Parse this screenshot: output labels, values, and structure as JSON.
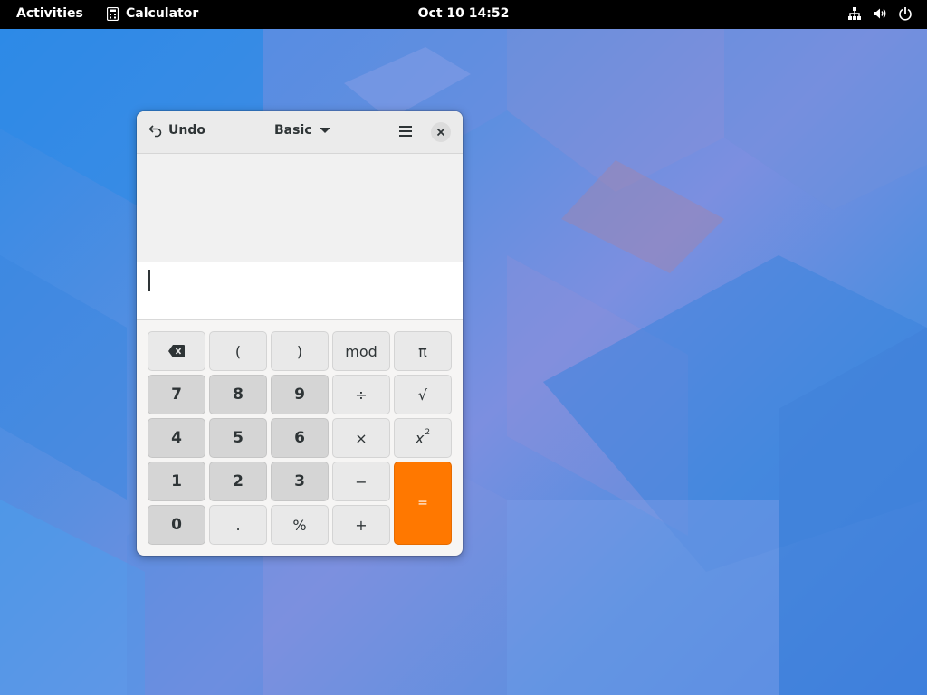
{
  "topbar": {
    "activities_label": "Activities",
    "app_name": "Calculator",
    "clock": "Oct 10  14:52",
    "tray_icons": [
      "network-icon",
      "volume-icon",
      "power-icon"
    ]
  },
  "window": {
    "undo_label": "Undo",
    "mode_label": "Basic",
    "entry_value": "",
    "keys": {
      "backspace": "backspace-icon",
      "lparen": "(",
      "rparen": ")",
      "mod": "mod",
      "pi": "π",
      "k7": "7",
      "k8": "8",
      "k9": "9",
      "divide": "÷",
      "sqrt": "√",
      "k4": "4",
      "k5": "5",
      "k6": "6",
      "multiply": "×",
      "square_base": "x",
      "square_exp": "2",
      "k1": "1",
      "k2": "2",
      "k3": "3",
      "subtract": "−",
      "equals": "=",
      "k0": "0",
      "point": ".",
      "percent": "%",
      "add": "+"
    }
  },
  "colors": {
    "equals_accent": "#ff7800",
    "topbar_bg": "#000000"
  }
}
